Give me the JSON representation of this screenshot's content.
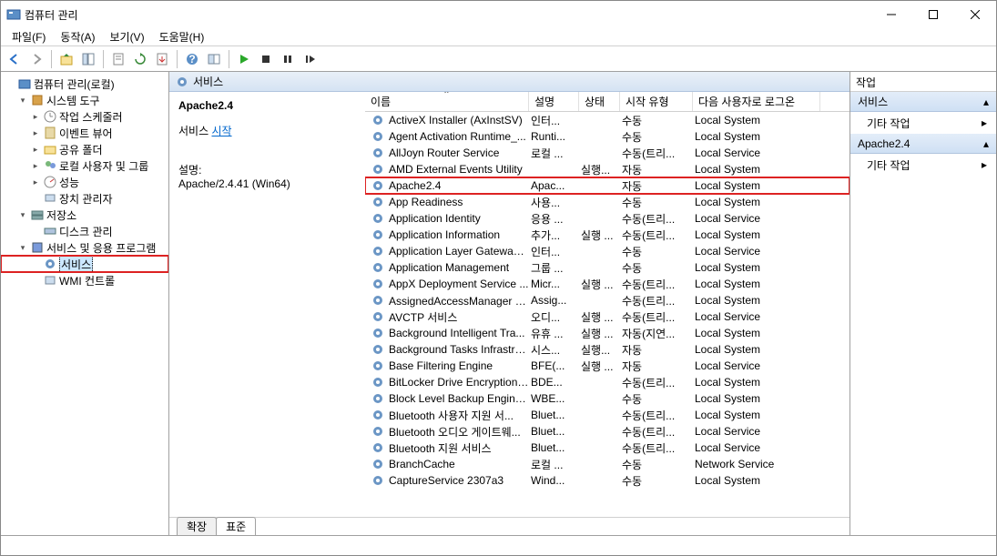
{
  "window": {
    "title": "컴퓨터 관리"
  },
  "menu": {
    "file": "파일(F)",
    "action": "동작(A)",
    "view": "보기(V)",
    "help": "도움말(H)"
  },
  "tree": {
    "root": "컴퓨터 관리(로컬)",
    "systools": "시스템 도구",
    "scheduler": "작업 스케줄러",
    "eventviewer": "이벤트 뷰어",
    "shared": "공유 폴더",
    "users": "로컬 사용자 및 그룹",
    "perf": "성능",
    "device": "장치 관리자",
    "storage": "저장소",
    "disk": "디스크 관리",
    "services_apps": "서비스 및 응용 프로그램",
    "services": "서비스",
    "wmi": "WMI 컨트롤"
  },
  "svc": {
    "panel_title": "서비스",
    "selected_name": "Apache2.4",
    "service_prefix": "서비스",
    "start_link": "시작",
    "desc_label": "설명:",
    "desc_value": "Apache/2.4.41 (Win64)",
    "tab_ext": "확장",
    "tab_std": "표준",
    "col_name": "이름",
    "col_desc": "설명",
    "col_status": "상태",
    "col_start": "시작 유형",
    "col_logon": "다음 사용자로 로그온",
    "rows": [
      {
        "n": "ActiveX Installer (AxInstSV)",
        "d": "인터...",
        "s": "",
        "t": "수동",
        "l": "Local System"
      },
      {
        "n": "Agent Activation Runtime_...",
        "d": "Runti...",
        "s": "",
        "t": "수동",
        "l": "Local System"
      },
      {
        "n": "AllJoyn Router Service",
        "d": "로컬 ...",
        "s": "",
        "t": "수동(트리...",
        "l": "Local Service"
      },
      {
        "n": "AMD External Events Utility",
        "d": "",
        "s": "실행...",
        "t": "자동",
        "l": "Local System"
      },
      {
        "n": "Apache2.4",
        "d": "Apac...",
        "s": "",
        "t": "자동",
        "l": "Local System",
        "hl": true
      },
      {
        "n": "App Readiness",
        "d": "사용...",
        "s": "",
        "t": "수동",
        "l": "Local System"
      },
      {
        "n": "Application Identity",
        "d": "응용 ...",
        "s": "",
        "t": "수동(트리...",
        "l": "Local Service"
      },
      {
        "n": "Application Information",
        "d": "추가...",
        "s": "실행 ...",
        "t": "수동(트리...",
        "l": "Local System"
      },
      {
        "n": "Application Layer Gateway ...",
        "d": "인터...",
        "s": "",
        "t": "수동",
        "l": "Local Service"
      },
      {
        "n": "Application Management",
        "d": "그룹 ...",
        "s": "",
        "t": "수동",
        "l": "Local System"
      },
      {
        "n": "AppX Deployment Service ...",
        "d": "Micr...",
        "s": "실행 ...",
        "t": "수동(트리...",
        "l": "Local System"
      },
      {
        "n": "AssignedAccessManager 서...",
        "d": "Assig...",
        "s": "",
        "t": "수동(트리...",
        "l": "Local System"
      },
      {
        "n": "AVCTP 서비스",
        "d": "오디...",
        "s": "실행 ...",
        "t": "수동(트리...",
        "l": "Local Service"
      },
      {
        "n": "Background Intelligent Tra...",
        "d": "유휴 ...",
        "s": "실행 ...",
        "t": "자동(지연...",
        "l": "Local System"
      },
      {
        "n": "Background Tasks Infrastru...",
        "d": "시스...",
        "s": "실행...",
        "t": "자동",
        "l": "Local System"
      },
      {
        "n": "Base Filtering Engine",
        "d": "BFE(...",
        "s": "실행 ...",
        "t": "자동",
        "l": "Local Service"
      },
      {
        "n": "BitLocker Drive Encryption ...",
        "d": "BDE...",
        "s": "",
        "t": "수동(트리...",
        "l": "Local System"
      },
      {
        "n": "Block Level Backup Engine ...",
        "d": "WBE...",
        "s": "",
        "t": "수동",
        "l": "Local System"
      },
      {
        "n": "Bluetooth 사용자 지원 서...",
        "d": "Bluet...",
        "s": "",
        "t": "수동(트리...",
        "l": "Local System"
      },
      {
        "n": "Bluetooth 오디오 게이트웨...",
        "d": "Bluet...",
        "s": "",
        "t": "수동(트리...",
        "l": "Local Service"
      },
      {
        "n": "Bluetooth 지원 서비스",
        "d": "Bluet...",
        "s": "",
        "t": "수동(트리...",
        "l": "Local Service"
      },
      {
        "n": "BranchCache",
        "d": "로컬 ...",
        "s": "",
        "t": "수동",
        "l": "Network Service"
      },
      {
        "n": "CaptureService 2307a3",
        "d": "Wind...",
        "s": "",
        "t": "수동",
        "l": "Local System"
      }
    ]
  },
  "actions": {
    "title": "작업",
    "sec1": "서비스",
    "more": "기타 작업",
    "sec2": "Apache2.4"
  }
}
